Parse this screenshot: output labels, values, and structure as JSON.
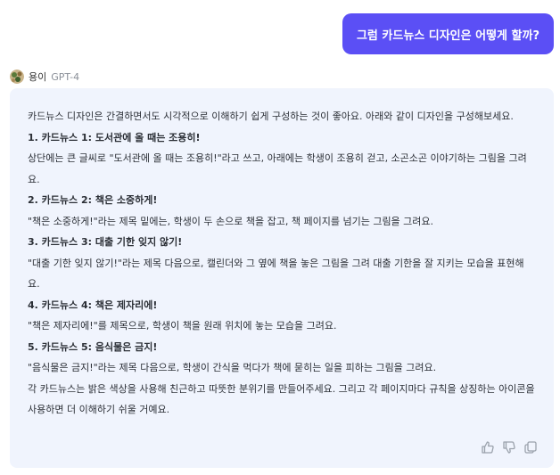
{
  "user_message": "그럼 카드뉴스 디자인은 어떻게 할까?",
  "assistant": {
    "name": "용이",
    "model": "GPT-4",
    "intro": "카드뉴스 디자인은 간결하면서도 시각적으로 이해하기 쉽게 구성하는 것이 좋아요. 아래와 같이 디자인을 구성해보세요.",
    "cards": [
      {
        "heading": "1. 카드뉴스 1: 도서관에 올 때는 조용히!",
        "body": "상단에는 큰 글씨로 \"도서관에 올 때는 조용히!\"라고 쓰고, 아래에는 학생이 조용히 걷고, 소곤소곤 이야기하는 그림을 그려요."
      },
      {
        "heading": "2. 카드뉴스 2: 책은 소중하게!",
        "body": "\"책은 소중하게!\"라는 제목 밑에는, 학생이 두 손으로 책을 잡고, 책 페이지를 넘기는 그림을 그려요."
      },
      {
        "heading": "3. 카드뉴스 3: 대출 기한 잊지 않기!",
        "body": "\"대출 기한 잊지 않기!\"라는 제목 다음으로, 캘린더와 그 옆에 책을 놓은 그림을 그려 대출 기한을 잘 지키는 모습을 표현해요."
      },
      {
        "heading": "4. 카드뉴스 4: 책은 제자리에!",
        "body": "\"책은 제자리에!\"를 제목으로, 학생이 책을 원래 위치에 놓는 모습을 그려요."
      },
      {
        "heading": "5. 카드뉴스 5: 음식물은 금지!",
        "body": "\"음식물은 금지!\"라는 제목 다음으로, 학생이 간식을 먹다가 책에 묻히는 일을 피하는 그림을 그려요."
      }
    ],
    "outro": "각 카드뉴스는 밝은 색상을 사용해 친근하고 따뜻한 분위기를 만들어주세요. 그리고 각 페이지마다 규칙을 상징하는 아이콘을 사용하면 더 이해하기 쉬울 거예요."
  },
  "actions": {
    "like_icon": "thumbs-up-icon",
    "dislike_icon": "thumbs-down-icon",
    "copy_icon": "copy-icon"
  },
  "colors": {
    "user_bubble": "#5b4ff5",
    "assistant_card": "#f0f4fd",
    "model_label": "#8a8f98"
  }
}
